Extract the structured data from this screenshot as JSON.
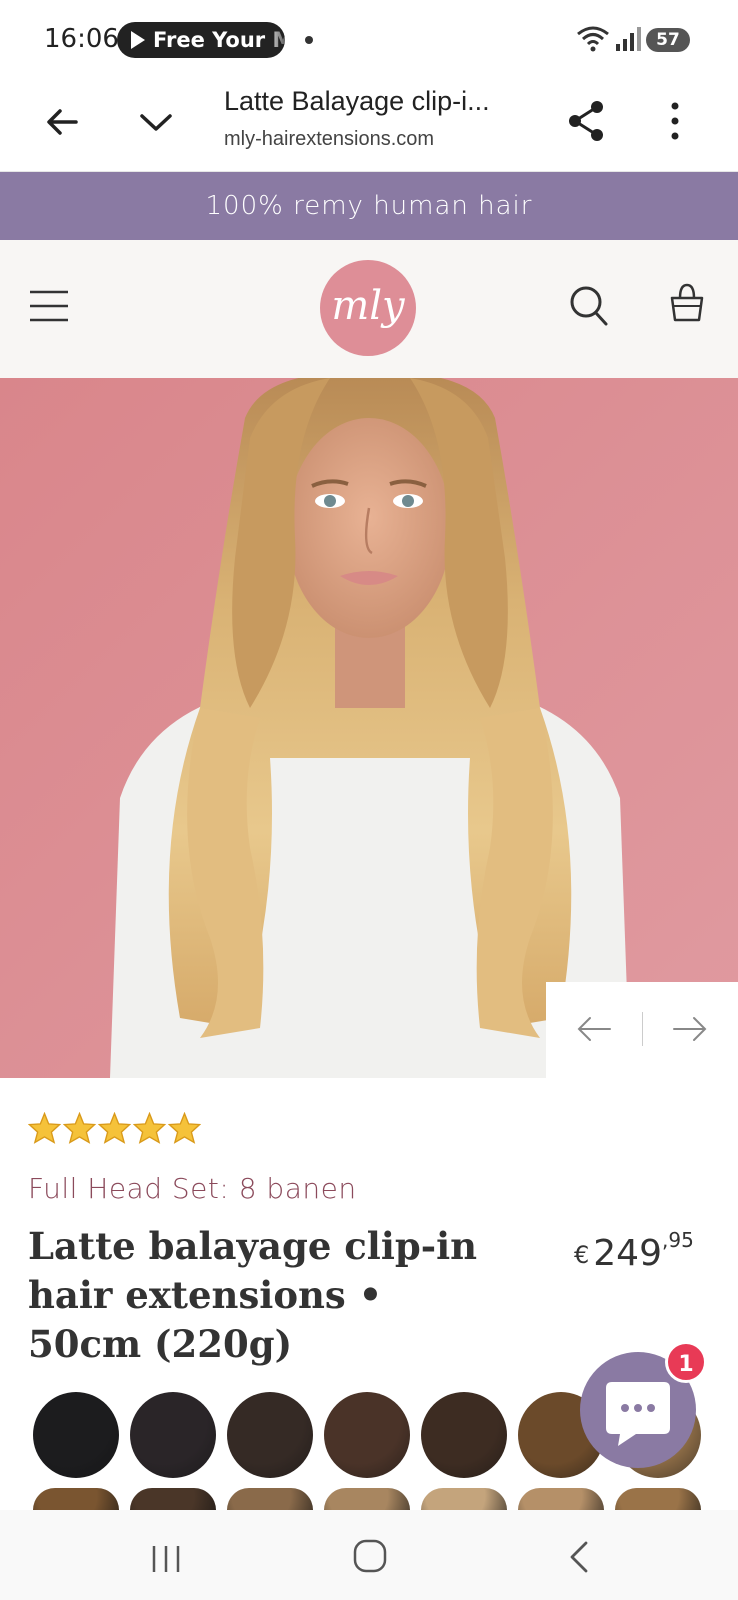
{
  "status_bar": {
    "time": "16:06",
    "media_label": "Free Your M",
    "battery": "57"
  },
  "browser": {
    "page_title": "Latte Balayage clip-i...",
    "url": "mly-hairextensions.com"
  },
  "announcement": "100% remy human hair",
  "store": {
    "logo_text": "mly"
  },
  "product": {
    "rating_stars": 5,
    "subtitle": "Full Head Set: 8 banen",
    "title": "Latte balayage clip-in hair extensions • 50cm (220g)",
    "price_currency": "€",
    "price_whole": "249",
    "price_cents": ",95"
  },
  "chat": {
    "badge_count": "1"
  },
  "colors": {
    "announcement_bg": "#8a7aa3",
    "logo_bg": "#de8e97",
    "hero_bg": "#d9878c",
    "subtitle": "#8b4a5b",
    "chat_bg": "#8a7aa3",
    "badge": "#e83a56"
  },
  "swatch_colors": [
    "#1c1c1e",
    "#2a2528",
    "#352a25",
    "#4a3328",
    "#3d2c22",
    "#6b4a2a",
    "#8a6a45"
  ],
  "swatch_colors_row2": [
    "#7a5530",
    "#4a3628",
    "#8a6a4a",
    "#a88660",
    "#c4a47c",
    "#b59068",
    "#9a7348"
  ]
}
